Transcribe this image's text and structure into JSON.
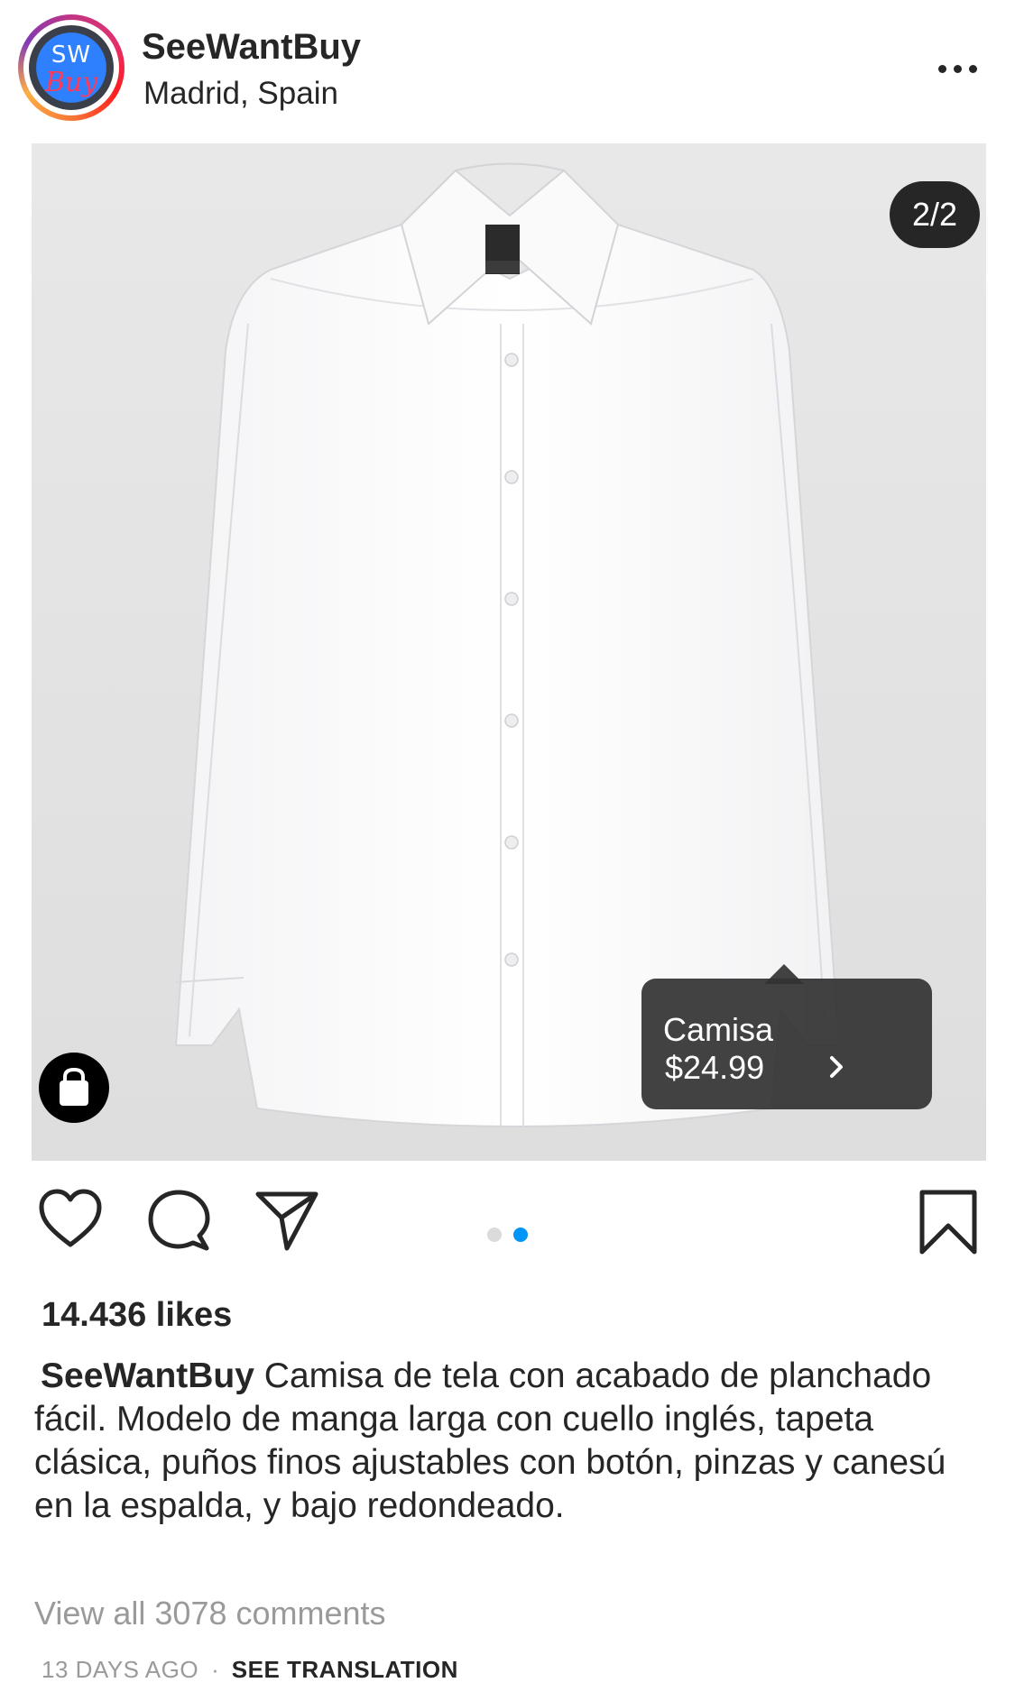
{
  "header": {
    "username": "SeeWantBuy",
    "location": "Madrid, Spain",
    "avatar_text_top": "SW",
    "avatar_text_bottom": "Buy",
    "more_icon": "more-horizontal-icon"
  },
  "photo": {
    "counter": "2/2",
    "shop_icon": "shopping-bag-icon",
    "product_tag": {
      "name": "Camisa",
      "price": "$24.99",
      "icon": "chevron-right-icon"
    }
  },
  "actions": {
    "like_icon": "heart-icon",
    "comment_icon": "comment-icon",
    "share_icon": "send-icon",
    "save_icon": "bookmark-icon",
    "carousel": {
      "total": 2,
      "active": 2,
      "active_color": "#0095f6",
      "inactive_color": "#dbdbdb"
    }
  },
  "likes": "14.436 likes",
  "caption": {
    "username": "SeeWantBuy",
    "text": "Camisa de tela con acabado de planchado fácil. Modelo de manga larga con cuello inglés, tapeta clásica, puños finos ajustables con botón, pinzas y canesú en la espalda, y bajo redondeado."
  },
  "view_comments": "View all 3078 comments",
  "timestamp": "13 DAYS AGO",
  "separator": "·",
  "see_translation": "SEE TRANSLATION"
}
